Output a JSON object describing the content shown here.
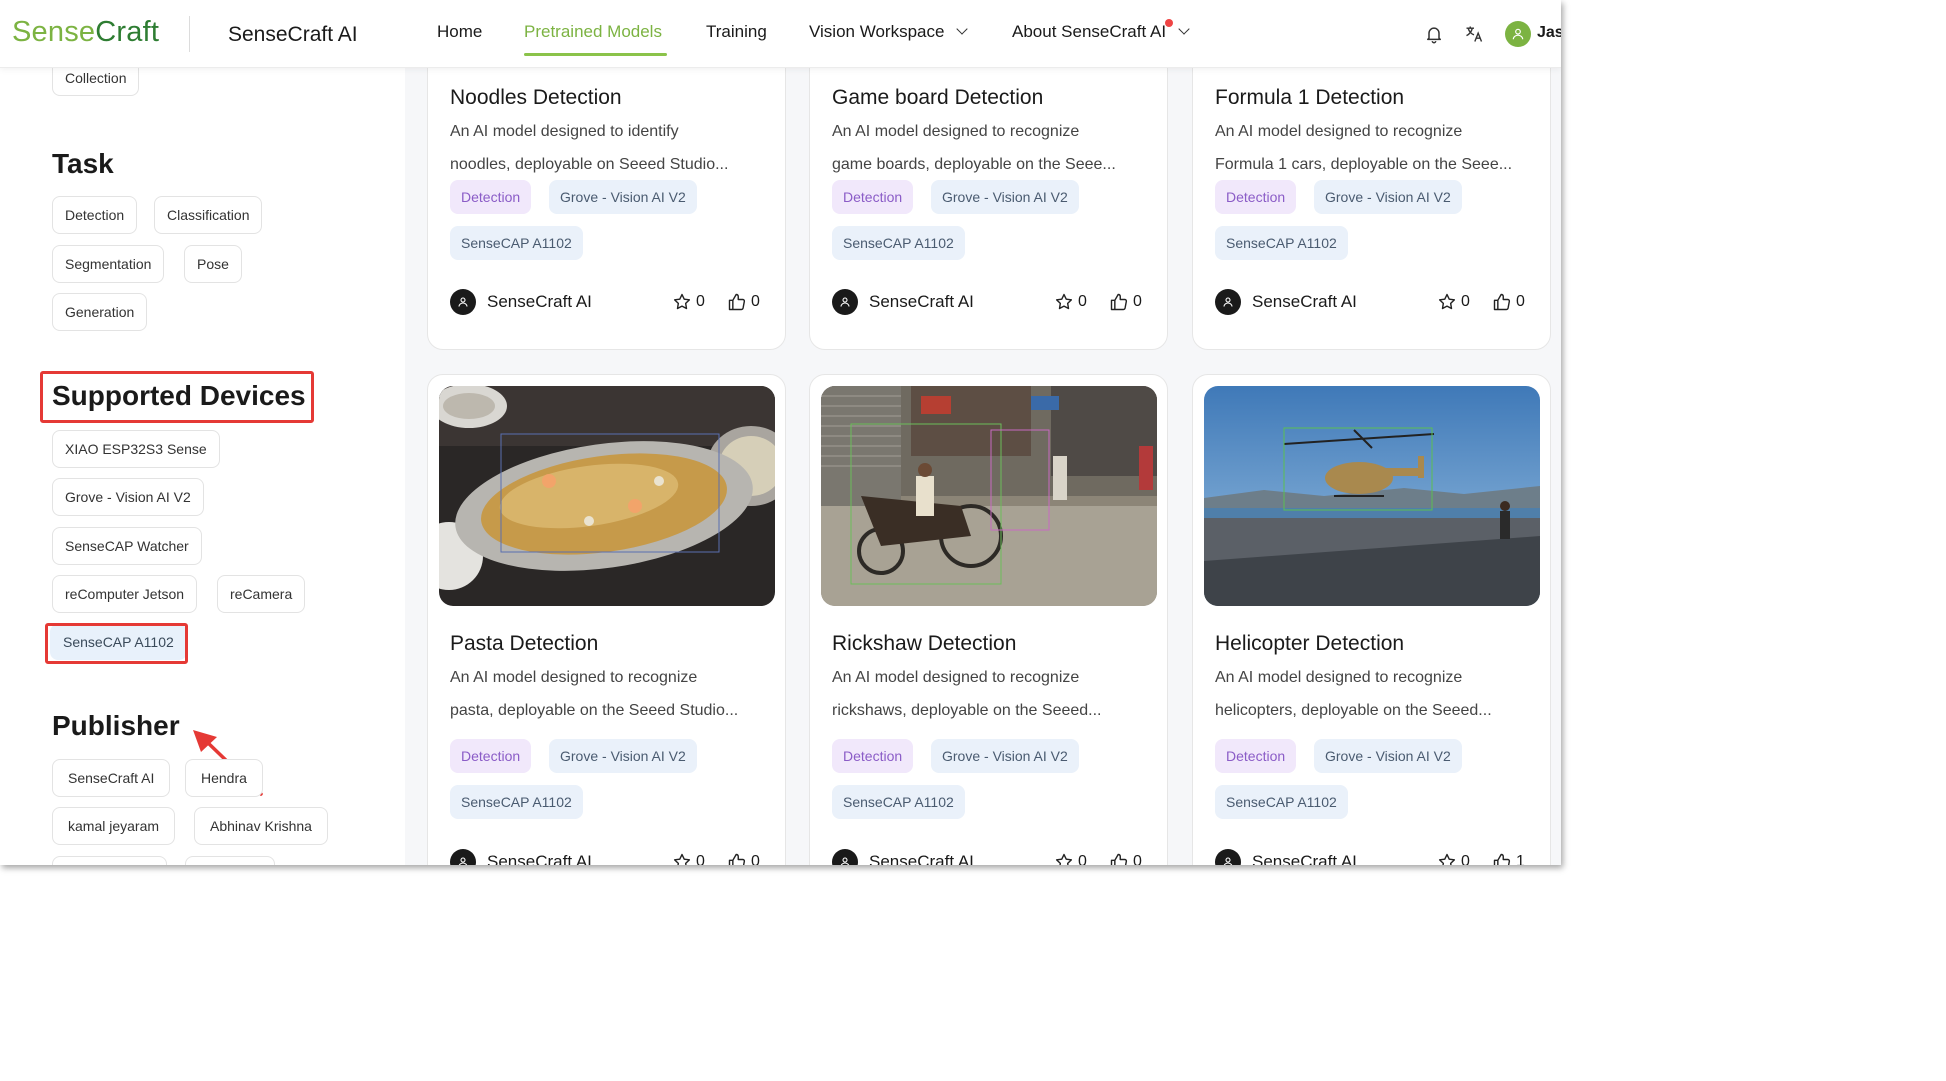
{
  "header": {
    "logo_part1": "Sense",
    "logo_part2": "Craft",
    "title": "SenseCraft AI",
    "nav": [
      {
        "label": "Home"
      },
      {
        "label": "Pretrained Models"
      },
      {
        "label": "Training"
      },
      {
        "label": "Vision Workspace"
      },
      {
        "label": "About SenseCraft AI"
      }
    ],
    "active_nav": "Pretrained Models",
    "user_name": "Jas"
  },
  "sidebar": {
    "top_partial": "Collection",
    "task_title": "Task",
    "tasks": [
      "Detection",
      "Classification",
      "Segmentation",
      "Pose",
      "Generation"
    ],
    "devices_title": "Supported Devices",
    "devices": [
      "XIAO ESP32S3 Sense",
      "Grove - Vision AI V2",
      "SenseCAP Watcher",
      "reComputer Jetson",
      "reCamera",
      "SenseCAP A1102"
    ],
    "selected_device": "SenseCAP A1102",
    "publisher_title": "Publisher",
    "publishers": [
      "SenseCraft AI",
      "Hendra",
      "kamal jeyaram",
      "Abhinav Krishna"
    ]
  },
  "cards": [
    {
      "title": "Noodles Detection",
      "desc1": "An AI model designed to identify",
      "desc2": "noodles, deployable on Seeed Studio...",
      "task": "Detection",
      "device1": "Grove - Vision AI V2",
      "device2": "SenseCAP A1102",
      "publisher": "SenseCraft AI",
      "stars": "0",
      "likes": "0"
    },
    {
      "title": "Game board Detection",
      "desc1": "An AI model designed to recognize",
      "desc2": "game boards, deployable on the Seee...",
      "task": "Detection",
      "device1": "Grove - Vision AI V2",
      "device2": "SenseCAP A1102",
      "publisher": "SenseCraft AI",
      "stars": "0",
      "likes": "0"
    },
    {
      "title": "Formula 1 Detection",
      "desc1": "An AI model designed to recognize",
      "desc2": "Formula 1 cars, deployable on the Seee...",
      "task": "Detection",
      "device1": "Grove - Vision AI V2",
      "device2": "SenseCAP A1102",
      "publisher": "SenseCraft AI",
      "stars": "0",
      "likes": "0"
    },
    {
      "title": "Pasta Detection",
      "desc1": "An AI model designed to recognize",
      "desc2": "pasta, deployable on the Seeed Studio...",
      "task": "Detection",
      "device1": "Grove - Vision AI V2",
      "device2": "SenseCAP A1102",
      "publisher": "SenseCraft AI",
      "stars": "0",
      "likes": "0"
    },
    {
      "title": "Rickshaw Detection",
      "desc1": "An AI model designed to recognize",
      "desc2": "rickshaws, deployable on the Seeed...",
      "task": "Detection",
      "device1": "Grove - Vision AI V2",
      "device2": "SenseCAP A1102",
      "publisher": "SenseCraft AI",
      "stars": "0",
      "likes": "0"
    },
    {
      "title": "Helicopter Detection",
      "desc1": "An AI model designed to recognize",
      "desc2": "helicopters, deployable on the Seeed...",
      "task": "Detection",
      "device1": "Grove - Vision AI V2",
      "device2": "SenseCAP A1102",
      "publisher": "SenseCraft AI",
      "stars": "0",
      "likes": "1"
    }
  ],
  "colors": {
    "brand_green": "#7cb342",
    "highlight_red": "#e53935",
    "task_tag_bg": "#f1e8fb",
    "device_tag_bg": "#eaf1fa"
  },
  "icons": [
    "bell-icon",
    "translate-icon",
    "user-icon",
    "chevron-down-icon",
    "star-icon",
    "thumbs-up-icon",
    "arrow-icon"
  ]
}
